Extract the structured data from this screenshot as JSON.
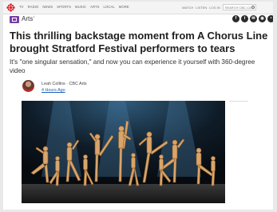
{
  "nav": {
    "links": [
      "TV",
      "RADIO",
      "NEWS",
      "SPORTS",
      "MUSIC",
      "ARTS",
      "LOCAL",
      "MORE"
    ],
    "right_links": [
      "WATCH",
      "LISTEN",
      "LOG IN"
    ],
    "search_placeholder": "SEARCH CBC.CA"
  },
  "section": {
    "name": "Arts",
    "social_icons": [
      "facebook-icon",
      "twitter-icon",
      "email-icon",
      "reddit-icon",
      "share-icon"
    ]
  },
  "article": {
    "headline": "This thrilling backstage moment from A Chorus Line brought Stratford Festival performers to tears",
    "deck": "It's \"one singular sensation,\" and now you can experience it yourself with 360-degree video",
    "author": "Leah Collins · CBC Arts",
    "time_ago": "4 Hours Ago"
  },
  "colors": {
    "section_accent": "#7a3ea6",
    "link_blue": "#1e63b6",
    "brand_red": "#d9282f"
  }
}
